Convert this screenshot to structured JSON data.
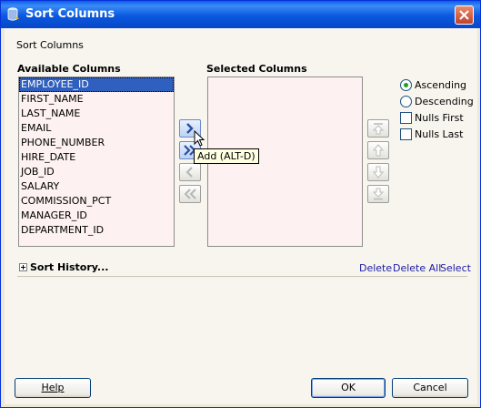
{
  "window": {
    "title": "Sort Columns",
    "section_label": "Sort Columns"
  },
  "available": {
    "header": "Available Columns",
    "items": [
      "EMPLOYEE_ID",
      "FIRST_NAME",
      "LAST_NAME",
      "EMAIL",
      "PHONE_NUMBER",
      "HIRE_DATE",
      "JOB_ID",
      "SALARY",
      "COMMISSION_PCT",
      "MANAGER_ID",
      "DEPARTMENT_ID"
    ],
    "selected_item": "EMPLOYEE_ID"
  },
  "selected": {
    "header": "Selected Columns",
    "items": []
  },
  "transfer": {
    "add_icon": "chevron-right-icon",
    "add_all_icon": "double-chevron-right-icon",
    "remove_icon": "chevron-left-icon",
    "remove_all_icon": "double-chevron-left-icon",
    "tooltip": "Add (ALT-D)"
  },
  "order_buttons": [
    "move-to-top-icon",
    "move-up-icon",
    "move-down-icon",
    "move-to-bottom-icon"
  ],
  "options": {
    "ascending": "Ascending",
    "descending": "Descending",
    "nulls_first": "Nulls First",
    "nulls_last": "Nulls Last",
    "sort_direction": "Ascending",
    "nulls_first_checked": false,
    "nulls_last_checked": false
  },
  "history": {
    "label": "Sort History...",
    "delete": "Delete",
    "delete_all": "Delete All",
    "select": "Select"
  },
  "footer": {
    "help": "Help",
    "ok": "OK",
    "cancel": "Cancel"
  },
  "colors": {
    "title_bar": "#0a58e0",
    "list_background": "#fdf1f1",
    "selection": "#2f5fbf",
    "link": "#1a1aa6",
    "radio_dot": "#21a121"
  }
}
